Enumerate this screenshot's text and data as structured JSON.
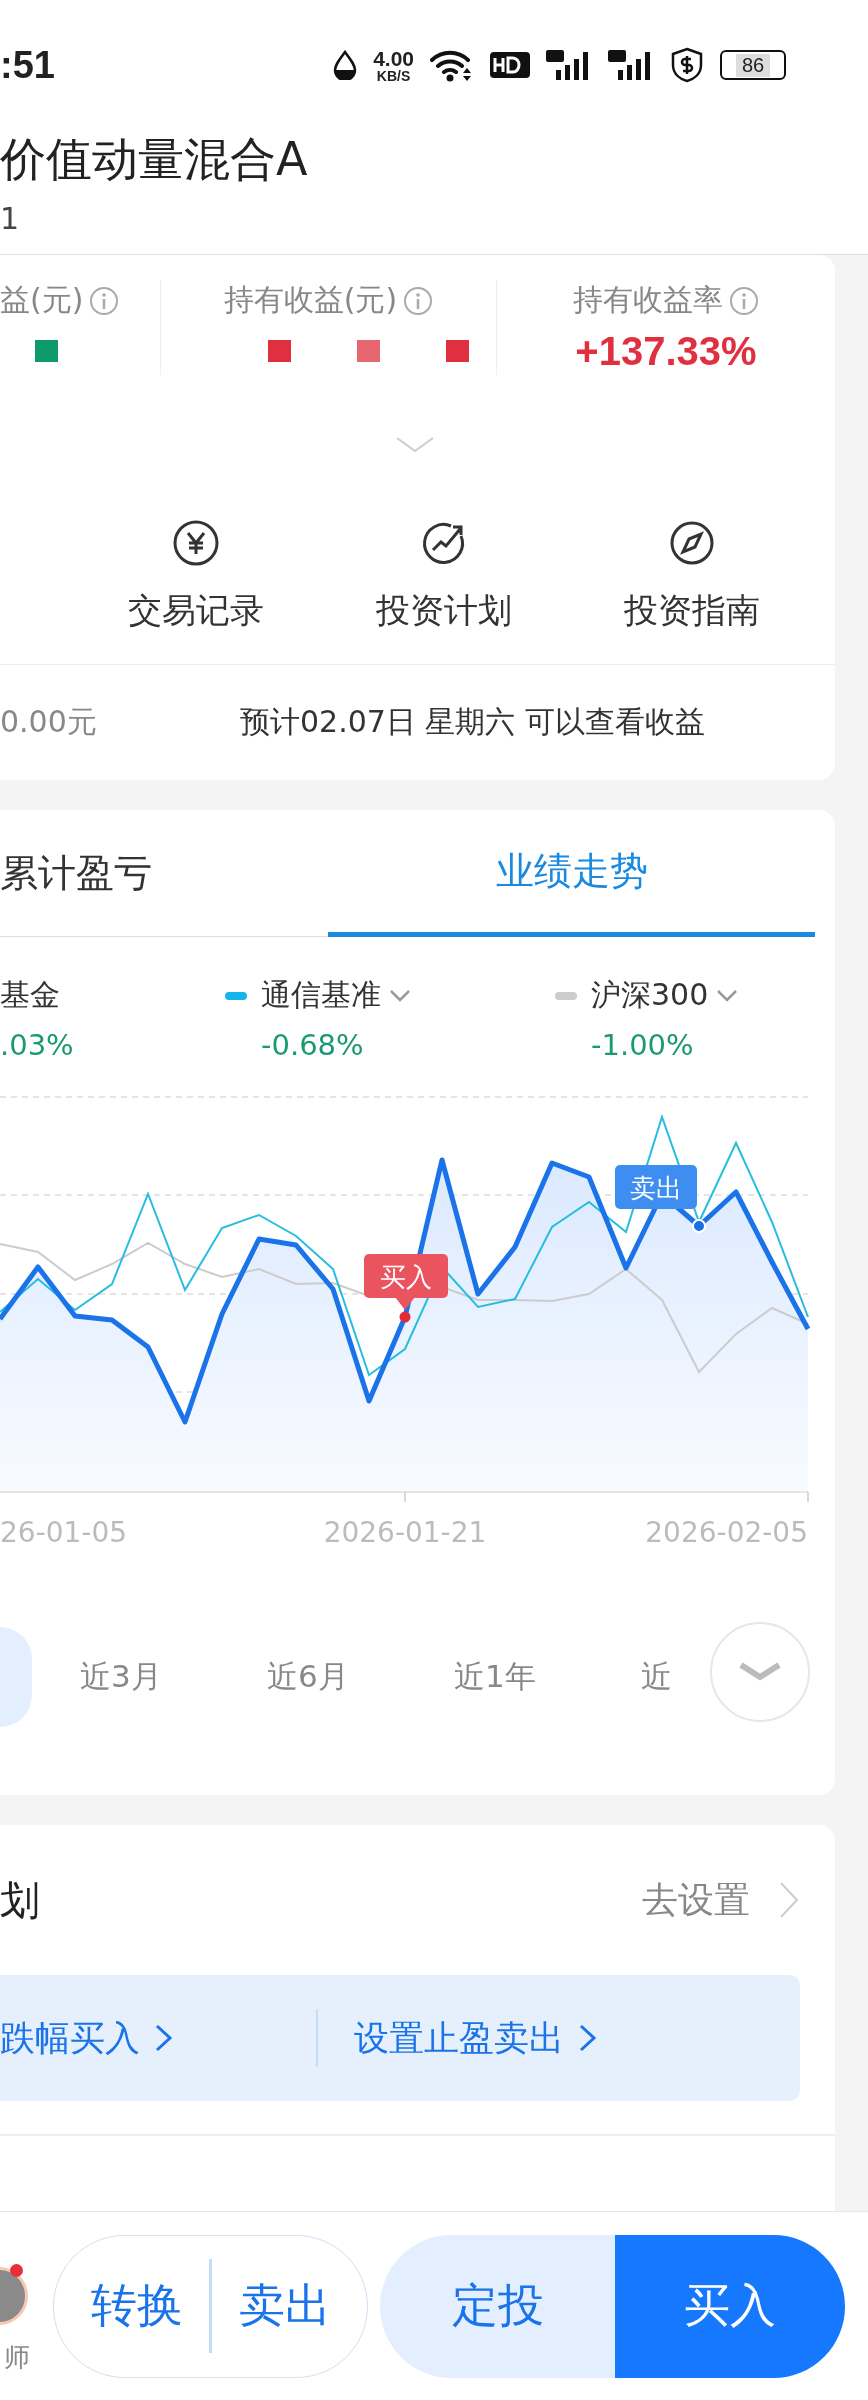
{
  "status_bar": {
    "time": ":51",
    "net_speed": "4.00",
    "net_unit": "KB/S",
    "battery": "86"
  },
  "header": {
    "title": "价值动量混合A",
    "code": "1"
  },
  "stats": [
    {
      "label": "益(元)",
      "kind": "masked",
      "color": "#0f9a6e"
    },
    {
      "label": "持有收益(元)",
      "kind": "masked",
      "color": "#e0303f"
    },
    {
      "label": "持有收益率",
      "kind": "text",
      "value": "+137.33%"
    }
  ],
  "actions": [
    {
      "label": "交易记录"
    },
    {
      "label": "投资计划"
    },
    {
      "label": "投资指南"
    }
  ],
  "yesterday_gain": "0.00元",
  "notice": "预计02.07日 星期六 可以查看收益",
  "tabs": [
    {
      "label": "累计盈亏",
      "selected": false
    },
    {
      "label": "业绩走势",
      "selected": true
    }
  ],
  "legend": [
    {
      "name": "基金",
      "value": ".03%"
    },
    {
      "name": "通信基准",
      "value": "-0.68%",
      "color": "#13b5ea"
    },
    {
      "name": "沪深300",
      "value": "-1.00%",
      "color": "#cccccc"
    }
  ],
  "chart": {
    "buy_label": "买入",
    "sell_label": "卖出",
    "x_labels": [
      "26-01-05",
      "2026-01-21",
      "2026-02-05"
    ]
  },
  "ranges": [
    {
      "label": "近3月",
      "selected": false
    },
    {
      "label": "近6月",
      "selected": false
    },
    {
      "label": "近1年",
      "selected": false
    },
    {
      "label": "近",
      "selected": false
    }
  ],
  "plan": {
    "title": "划",
    "action": "去设置",
    "links": [
      "跌幅买入",
      "设置止盈卖出"
    ]
  },
  "bottom_bar": {
    "advisor": "师",
    "buttons": [
      {
        "label": "转换",
        "kind": "outline"
      },
      {
        "label": "卖出",
        "kind": "outline"
      },
      {
        "label": "定投",
        "kind": "light"
      },
      {
        "label": "买入",
        "kind": "primary"
      }
    ]
  }
}
